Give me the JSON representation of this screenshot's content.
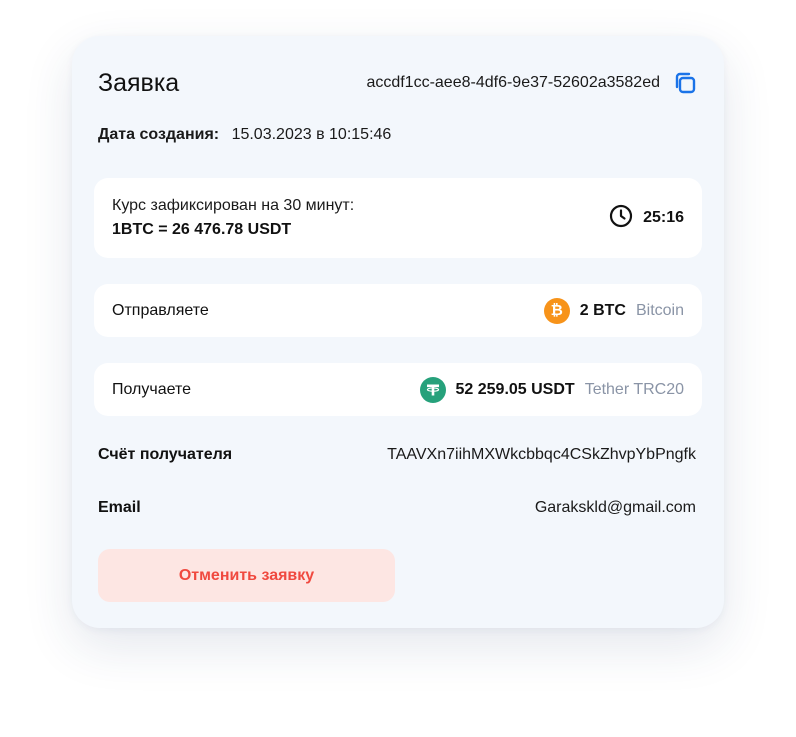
{
  "order": {
    "title": "Заявка",
    "id": "accdf1cc-aee8-4df6-9e37-52602a3582ed",
    "created_label": "Дата создания:",
    "created_value": "15.03.2023 в 10:15:46"
  },
  "rate": {
    "line1": "Курс зафиксирован на 30 минут:",
    "line2": "1BTC = 26 476.78 USDT",
    "timer": "25:16"
  },
  "send": {
    "label": "Отправляете",
    "amount": "2 BTC",
    "network": "Bitcoin",
    "icon": "bitcoin-icon",
    "color": "#f7931a"
  },
  "receive": {
    "label": "Получаете",
    "amount": "52 259.05 USDT",
    "network": "Tether TRC20",
    "icon": "tether-icon",
    "color": "#26a17b"
  },
  "account": {
    "label": "Счёт получателя",
    "value": "TAAVXn7iihMXWkcbbqc4CSkZhvpYbPngfk"
  },
  "email": {
    "label": "Email",
    "value": "Garakskld@gmail.com"
  },
  "actions": {
    "cancel_label": "Отменить заявку"
  },
  "colors": {
    "accent": "#1a73e8",
    "danger": "#f0493f",
    "danger_bg": "#fde6e3"
  }
}
